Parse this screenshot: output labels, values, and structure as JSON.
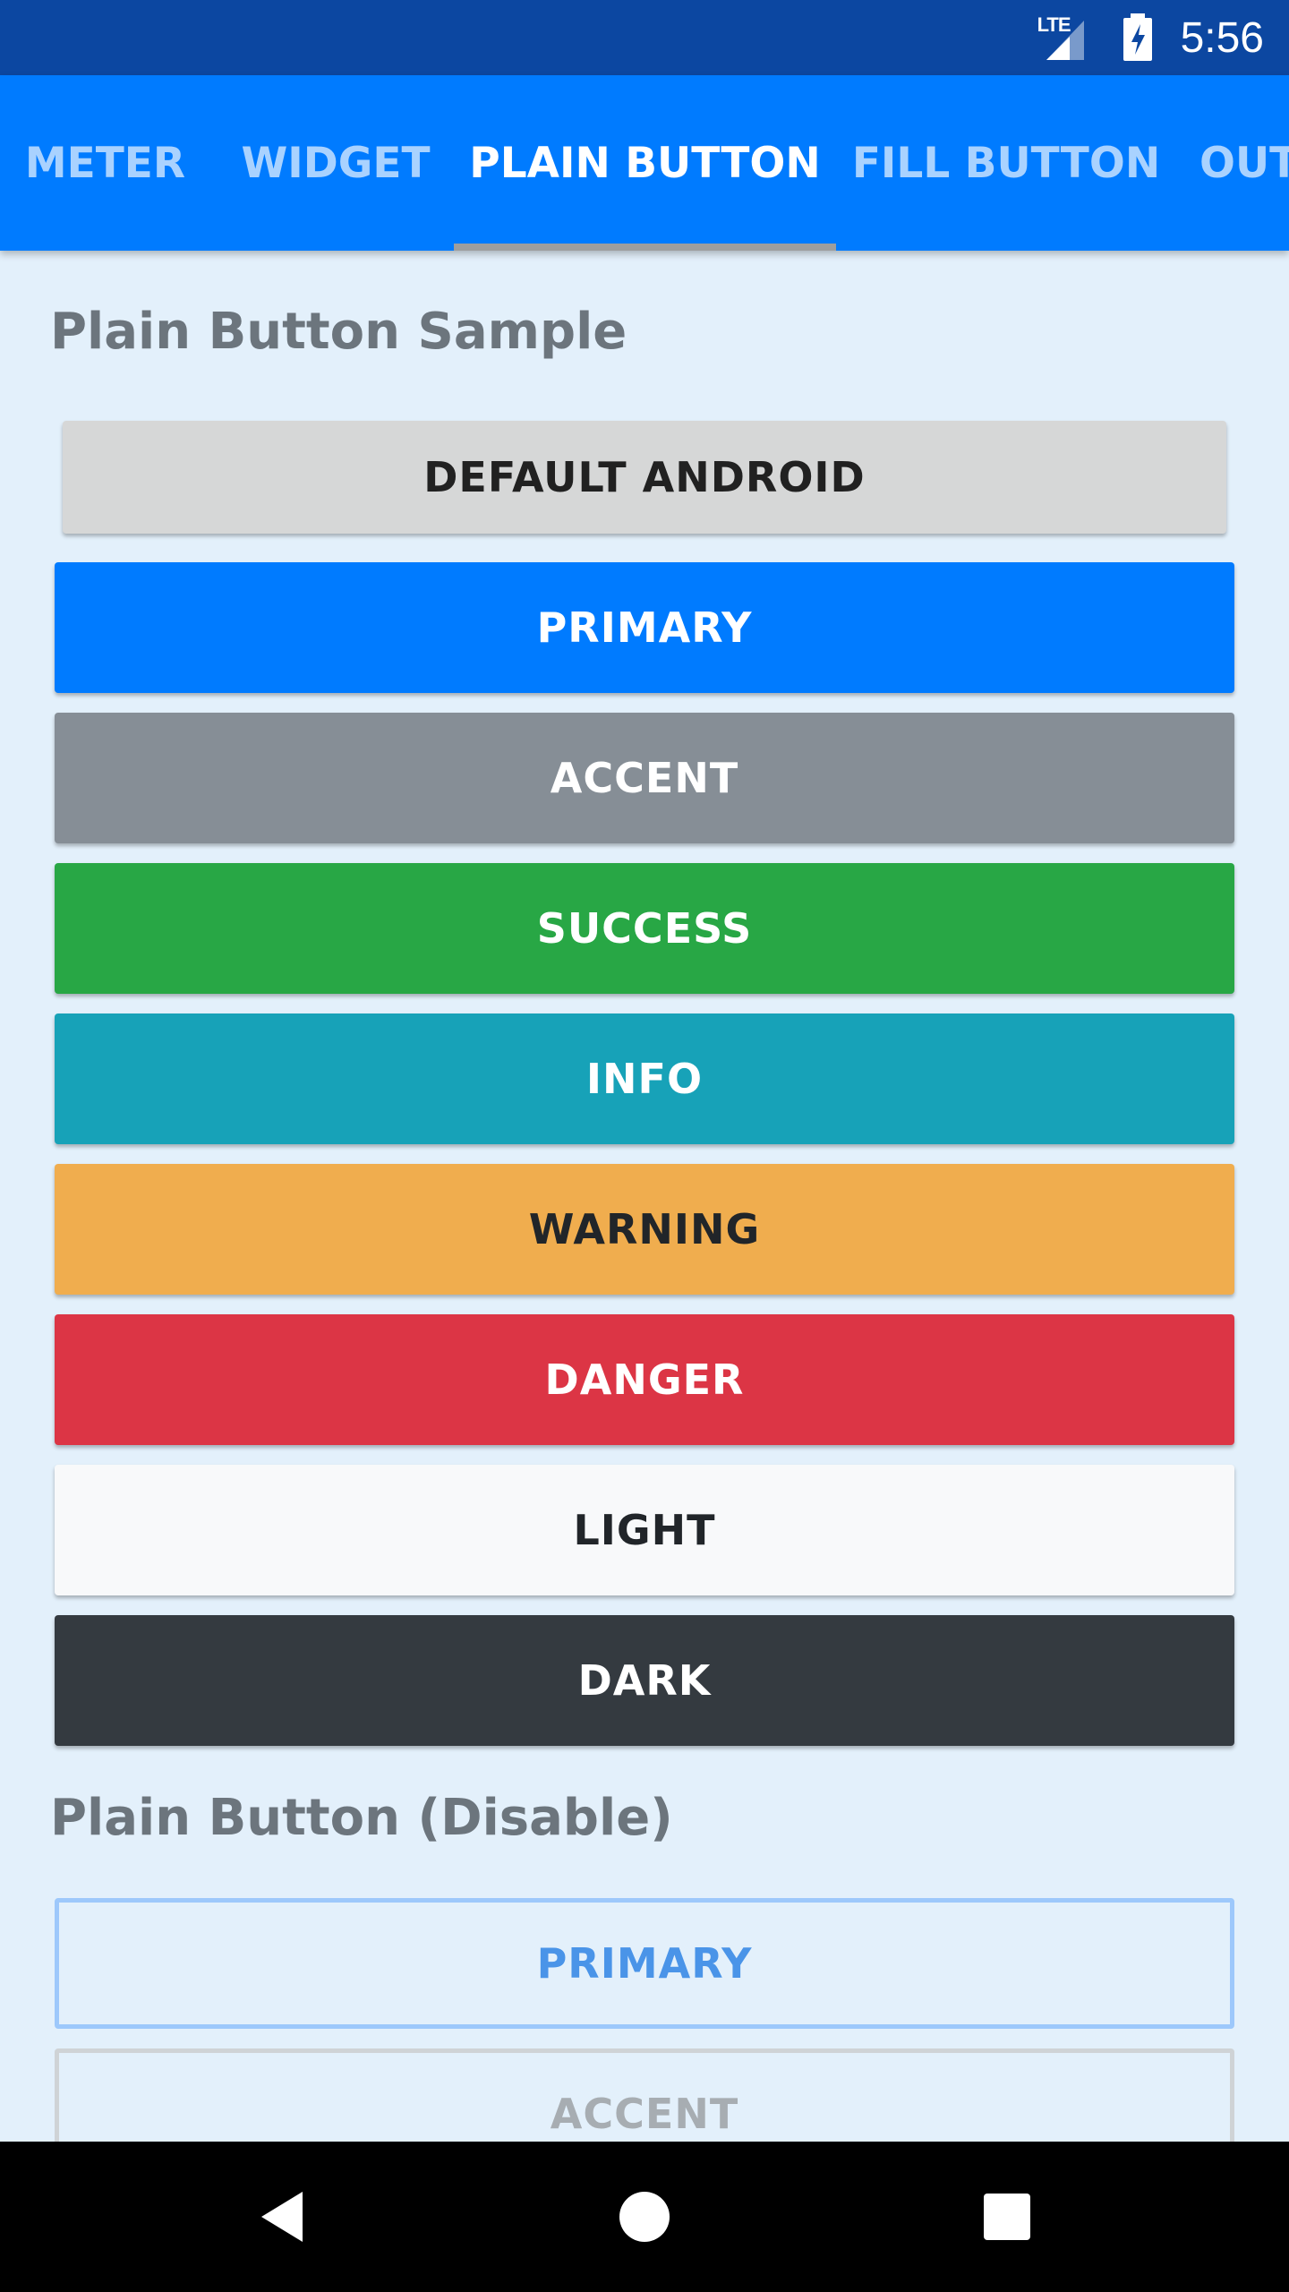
{
  "status_bar": {
    "network_label": "LTE",
    "time": "5:56"
  },
  "tabs": [
    {
      "label": "METER",
      "active": false
    },
    {
      "label": "WIDGET",
      "active": false
    },
    {
      "label": "PLAIN BUTTON",
      "active": true
    },
    {
      "label": "FILL BUTTON",
      "active": false
    },
    {
      "label": "OUT",
      "active": false
    }
  ],
  "sections": {
    "sample_title": "Plain Button Sample",
    "disable_title": "Plain Button (Disable)"
  },
  "buttons": {
    "default_android": "DEFAULT ANDROID",
    "primary": "PRIMARY",
    "accent": "ACCENT",
    "success": "SUCCESS",
    "info": "INFO",
    "warning": "WARNING",
    "danger": "DANGER",
    "light": "LIGHT",
    "dark": "DARK"
  },
  "disabled_buttons": {
    "primary": "PRIMARY",
    "accent": "ACCENT"
  },
  "colors": {
    "status_bar": "#0c47a1",
    "tab_bar": "#007bff",
    "primary": "#007bff",
    "accent": "#868e96",
    "success": "#28a745",
    "info": "#17a2b8",
    "warning": "#f0ad4e",
    "danger": "#dc3545",
    "light": "#f8f9fa",
    "dark": "#343a40",
    "background": "#e3f0fb"
  },
  "icons": {
    "signal": "signal-icon",
    "battery": "battery-charging-icon",
    "back": "back-icon",
    "home": "home-icon",
    "recents": "recents-icon"
  }
}
